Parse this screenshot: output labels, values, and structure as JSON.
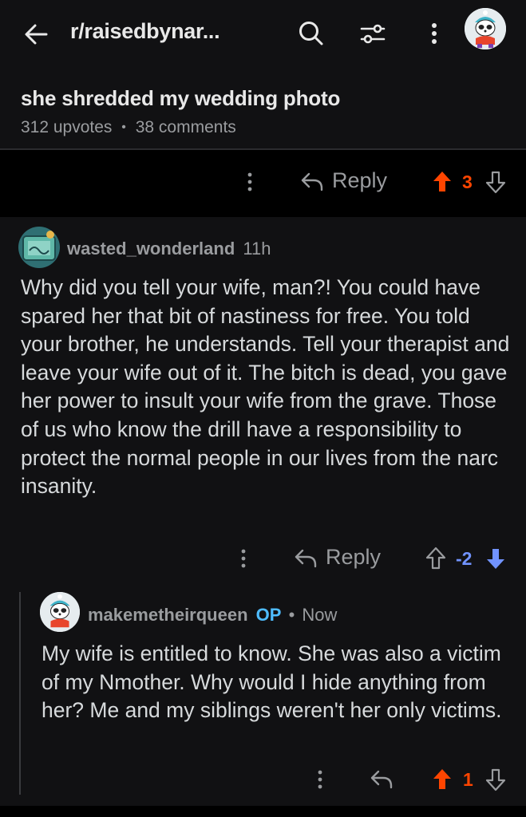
{
  "topbar": {
    "subreddit": "r/raisedbynar...",
    "icons": [
      "back-arrow-icon",
      "search-icon",
      "filter-icon",
      "more-vertical-icon",
      "user-avatar"
    ]
  },
  "post": {
    "title": "she shredded my wedding photo",
    "upvotes": "312 upvotes",
    "separator": "•",
    "comments": "38 comments"
  },
  "post_actions": {
    "reply_label": "Reply",
    "vote_count": "3",
    "vote_state": "upvoted"
  },
  "comments": [
    {
      "username": "wasted_wonderland",
      "time": "11h",
      "body": "Why did you tell your wife, man?! You could have spared her that bit of nastiness for free. You told your brother, he understands. Tell your therapist and leave your wife out of it. The bitch is dead, you gave her power to insult your wife from the grave. Those of us who know the drill have a responsibility to protect the normal people in our lives from the narc insanity.",
      "reply_label": "Reply",
      "vote_count": "-2",
      "vote_state": "downvoted"
    },
    {
      "username": "makemetheirqueen",
      "op_badge": "OP",
      "separator": "•",
      "time": "Now",
      "body": "My wife is entitled to know. She was also a victim of my Nmother. Why would I hide anything from her? Me and my siblings weren't her only victims.",
      "vote_count": "1",
      "vote_state": "upvoted"
    }
  ],
  "colors": {
    "upvote": "#ff4500",
    "downvote": "#7193ff",
    "op": "#4fbcff",
    "background": "#111113",
    "text": "#d7dadc",
    "muted": "#9a9c9f"
  }
}
